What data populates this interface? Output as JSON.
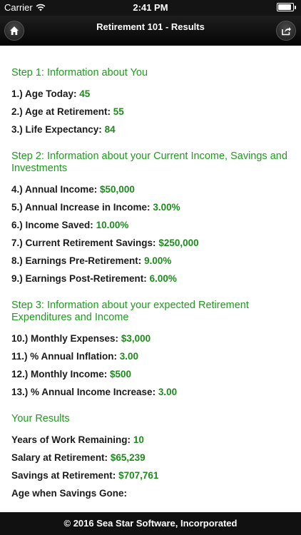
{
  "status_bar": {
    "carrier": "Carrier",
    "time": "2:41 PM",
    "icons": [
      "wifi-icon",
      "battery-icon"
    ]
  },
  "nav": {
    "title": "Retirement 101 - Results",
    "left_icon": "home-icon",
    "right_icon": "share-icon"
  },
  "steps": [
    {
      "title": "Step 1: Information about You",
      "items": [
        {
          "label": "1.) Age Today:",
          "value": "45"
        },
        {
          "label": "2.) Age at Retirement:",
          "value": "55"
        },
        {
          "label": "3.) Life Expectancy:",
          "value": "84"
        }
      ]
    },
    {
      "title": "Step 2: Information about your Current Income, Savings and Investments",
      "items": [
        {
          "label": "4.) Annual Income:",
          "value": "$50,000"
        },
        {
          "label": "5.) Annual Increase in Income:",
          "value": "3.00%"
        },
        {
          "label": "6.) Income Saved:",
          "value": "10.00%"
        },
        {
          "label": "7.) Current Retirement Savings:",
          "value": "$250,000"
        },
        {
          "label": "8.) Earnings Pre-Retirement:",
          "value": "9.00%"
        },
        {
          "label": "9.) Earnings Post-Retirement:",
          "value": "6.00%"
        }
      ]
    },
    {
      "title": "Step 3: Information about your expected Retirement Expenditures and Income",
      "items": [
        {
          "label": "10.) Monthly Expenses:",
          "value": "$3,000"
        },
        {
          "label": "11.) % Annual Inflation:",
          "value": "3.00"
        },
        {
          "label": "12.) Monthly Income:",
          "value": "$500"
        },
        {
          "label": "13.) % Annual Income Increase:",
          "value": "3.00"
        }
      ]
    },
    {
      "title": "Your Results",
      "items": [
        {
          "label": "Years of Work Remaining:",
          "value": "10"
        },
        {
          "label": "Salary at Retirement:",
          "value": "$65,239"
        },
        {
          "label": "Savings at Retirement:",
          "value": "$707,761"
        },
        {
          "label": "Age when Savings Gone:",
          "value": ""
        }
      ]
    }
  ],
  "footer": {
    "text": "© 2016 Sea Star Software, Incorporated"
  },
  "colors": {
    "accent_green": "#1f9a1f",
    "value_green": "#1c8b1c",
    "bar_background": "#111111"
  }
}
